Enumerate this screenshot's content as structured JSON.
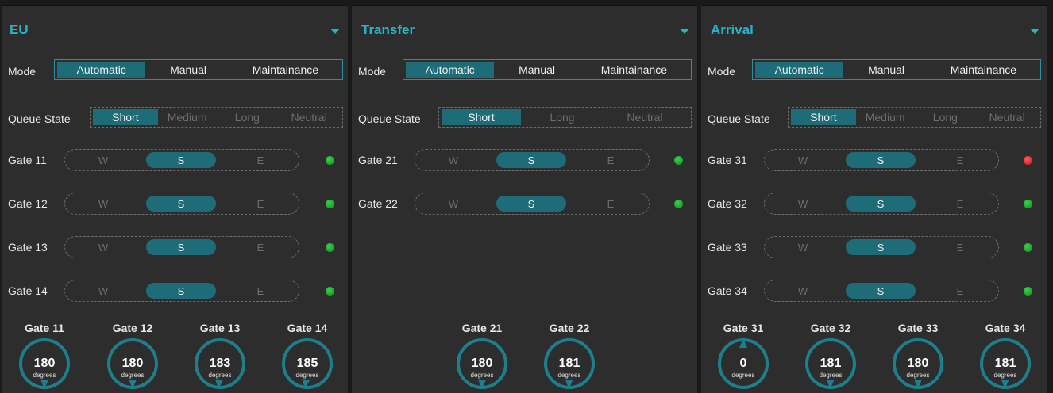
{
  "colors": {
    "accent": "#27b3c9",
    "active": "#1d6c78",
    "panel": "#2d2d2d",
    "ok": "#1fbf2f",
    "alert": "#ff2020"
  },
  "labels": {
    "mode": "Mode",
    "queue": "Queue State",
    "degrees": "degrees"
  },
  "panels": [
    {
      "title": "EU",
      "mode_options": [
        "Automatic",
        "Manual",
        "Maintainance"
      ],
      "mode_selected": "Automatic",
      "queue_options": [
        "Short",
        "Medium",
        "Long",
        "Neutral"
      ],
      "queue_selected": "Short",
      "gates": [
        {
          "label": "Gate 11",
          "dir": [
            "W",
            "S",
            "E"
          ],
          "selected": "S",
          "status": "green"
        },
        {
          "label": "Gate 12",
          "dir": [
            "W",
            "S",
            "E"
          ],
          "selected": "S",
          "status": "green"
        },
        {
          "label": "Gate 13",
          "dir": [
            "W",
            "S",
            "E"
          ],
          "selected": "S",
          "status": "green"
        },
        {
          "label": "Gate 14",
          "dir": [
            "W",
            "S",
            "E"
          ],
          "selected": "S",
          "status": "green"
        }
      ],
      "gauges": [
        {
          "label": "Gate 11",
          "value": "180",
          "angle": 180
        },
        {
          "label": "Gate 12",
          "value": "180",
          "angle": 180
        },
        {
          "label": "Gate 13",
          "value": "183",
          "angle": 183
        },
        {
          "label": "Gate 14",
          "value": "185",
          "angle": 185
        }
      ]
    },
    {
      "title": "Transfer",
      "mode_options": [
        "Automatic",
        "Manual",
        "Maintainance"
      ],
      "mode_selected": "Automatic",
      "queue_options": [
        "Short",
        "Long",
        "Neutral"
      ],
      "queue_selected": "Short",
      "gates": [
        {
          "label": "Gate 21",
          "dir": [
            "W",
            "S",
            "E"
          ],
          "selected": "S",
          "status": "green"
        },
        {
          "label": "Gate 22",
          "dir": [
            "W",
            "S",
            "E"
          ],
          "selected": "S",
          "status": "green"
        }
      ],
      "gauges": [
        {
          "label": "Gate 21",
          "value": "180",
          "angle": 180
        },
        {
          "label": "Gate 22",
          "value": "181",
          "angle": 181
        }
      ]
    },
    {
      "title": "Arrival",
      "mode_options": [
        "Automatic",
        "Manual",
        "Maintainance"
      ],
      "mode_selected": "Automatic",
      "queue_options": [
        "Short",
        "Medium",
        "Long",
        "Neutral"
      ],
      "queue_selected": "Short",
      "gates": [
        {
          "label": "Gate 31",
          "dir": [
            "W",
            "S",
            "E"
          ],
          "selected": "S",
          "status": "red"
        },
        {
          "label": "Gate 32",
          "dir": [
            "W",
            "S",
            "E"
          ],
          "selected": "S",
          "status": "green"
        },
        {
          "label": "Gate 33",
          "dir": [
            "W",
            "S",
            "E"
          ],
          "selected": "S",
          "status": "green"
        },
        {
          "label": "Gate 34",
          "dir": [
            "W",
            "S",
            "E"
          ],
          "selected": "S",
          "status": "green"
        }
      ],
      "gauges": [
        {
          "label": "Gate 31",
          "value": "0",
          "angle": 0
        },
        {
          "label": "Gate 32",
          "value": "181",
          "angle": 181
        },
        {
          "label": "Gate 33",
          "value": "180",
          "angle": 180
        },
        {
          "label": "Gate 34",
          "value": "181",
          "angle": 181
        }
      ]
    }
  ]
}
